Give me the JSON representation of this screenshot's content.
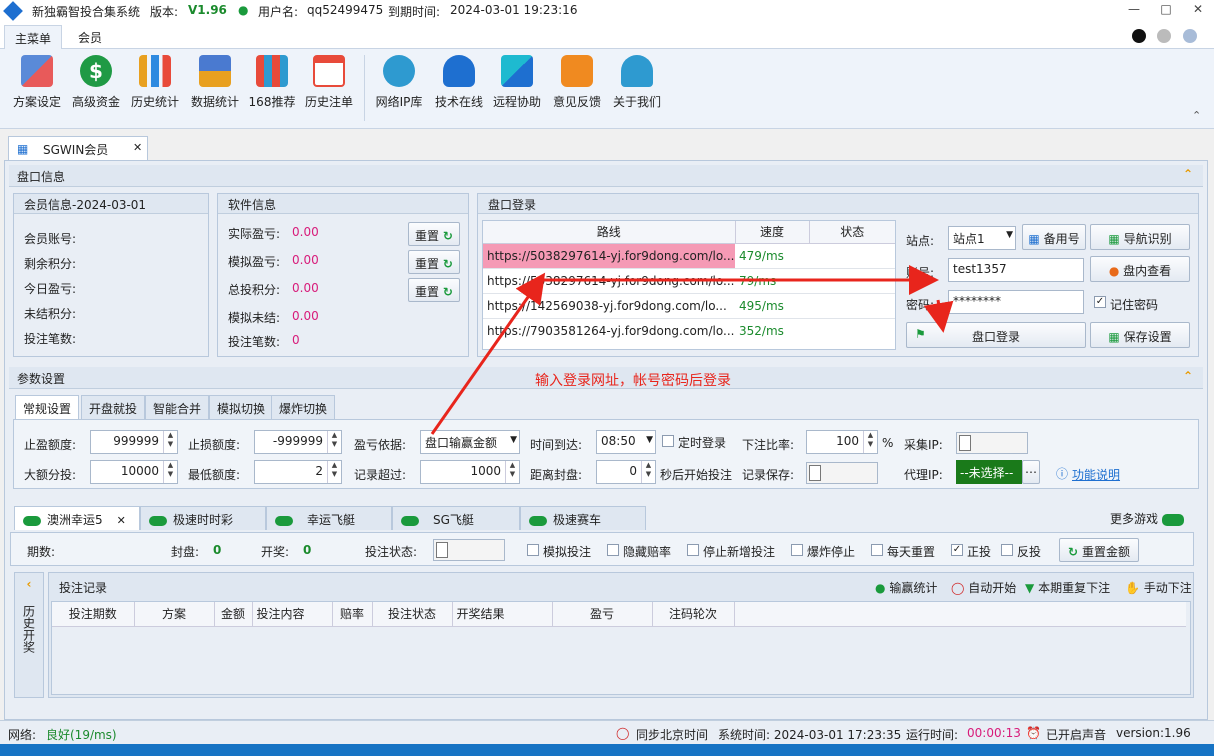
{
  "titlebar": {
    "app_name": "新独霸智投合集系统",
    "version_label": "版本:",
    "version": "V1.96",
    "user_label": "用户名:",
    "username": "qq52499475",
    "expire_label": "到期时间:",
    "expire_time": "2024-03-01 19:23:16"
  },
  "menu_tabs": [
    "主菜单",
    "会员"
  ],
  "ribbon": [
    "方案设定",
    "高级资金",
    "历史统计",
    "数据统计",
    "168推荐",
    "历史注单",
    "网络IP库",
    "技术在线",
    "远程协助",
    "意见反馈",
    "关于我们"
  ],
  "doc_tab": "SGWIN会员",
  "panels": {
    "market": "盘口信息",
    "member_info": "会员信息-2024-03-01",
    "software_info": "软件信息",
    "login": "盘口登录",
    "params": "参数设置"
  },
  "member_fields": [
    "会员账号:",
    "剩余积分:",
    "今日盈亏:",
    "未结积分:",
    "投注笔数:"
  ],
  "software_fields": [
    {
      "label": "实际盈亏:",
      "value": "0.00"
    },
    {
      "label": "模拟盈亏:",
      "value": "0.00"
    },
    {
      "label": "总投积分:",
      "value": "0.00"
    },
    {
      "label": "模拟未结:",
      "value": "0.00"
    },
    {
      "label": "投注笔数:",
      "value": "0"
    }
  ],
  "reset_label": "重置",
  "routes": {
    "headers": [
      "路线",
      "速度",
      "状态"
    ],
    "rows": [
      {
        "url": "https://5038297614-yj.for9dong.com/lo...",
        "speed": "479/ms"
      },
      {
        "url": "https://5038297614-yj.for9dong.com/lo...",
        "speed": "79/ms"
      },
      {
        "url": "https://142569038-yj.for9dong.com/lo...",
        "speed": "495/ms"
      },
      {
        "url": "https://7903581264-yj.for9dong.com/lo...",
        "speed": "352/ms"
      }
    ]
  },
  "login": {
    "site_label": "站点:",
    "site_value": "站点1",
    "backup": "备用号",
    "nav": "导航识别",
    "account_label": "账号:",
    "account": "test1357",
    "view_inside": "盘内查看",
    "password_label": "密码:",
    "password": "********",
    "remember": "记住密码",
    "login_btn": "盘口登录",
    "save_btn": "保存设置"
  },
  "annotation": "输入登录网址，帐号密码后登录",
  "param_tabs": [
    "常规设置",
    "开盘就投",
    "智能合并",
    "模拟切换",
    "爆炸切换"
  ],
  "params": {
    "stop_profit_label": "止盈额度:",
    "stop_profit": "999999",
    "stop_loss_label": "止损额度:",
    "stop_loss": "-999999",
    "basis_label": "盈亏依据:",
    "basis": "盘口输赢金额",
    "time_label": "时间到达:",
    "time": "08:50",
    "timed_login": "定时登录",
    "ratio_label": "下注比率:",
    "ratio": "100",
    "ratio_unit": "%",
    "collect_ip_label": "采集IP:",
    "split_label": "大额分投:",
    "split": "10000",
    "min_label": "最低额度:",
    "min": "2",
    "record_label": "记录超过:",
    "record": "1000",
    "close_label": "距离封盘:",
    "close": "0",
    "close_suffix": "秒后开始投注",
    "record_save_label": "记录保存:",
    "proxy_label": "代理IP:",
    "proxy": "--未选择--",
    "help": "功能说明"
  },
  "game_tabs": [
    "澳洲幸运5",
    "极速时时彩",
    "幸运飞艇",
    "SG飞艇",
    "极速赛车"
  ],
  "more_games": "更多游戏",
  "game_bar": {
    "period": "期数:",
    "close": "封盘:",
    "close_val": "0",
    "draw": "开奖:",
    "draw_val": "0",
    "bet_state": "投注状态:",
    "checks": [
      {
        "label": "模拟投注",
        "on": false
      },
      {
        "label": "隐藏赔率",
        "on": false
      },
      {
        "label": "停止新增投注",
        "on": false
      },
      {
        "label": "爆炸停止",
        "on": false
      },
      {
        "label": "每天重置",
        "on": false
      },
      {
        "label": "正投",
        "on": true
      },
      {
        "label": "反投",
        "on": false
      }
    ],
    "reset_amount": "重置金额"
  },
  "history_side": "历史开奖",
  "records": {
    "title": "投注记录",
    "actions": [
      "输赢统计",
      "自动开始",
      "本期重复下注",
      "手动下注"
    ],
    "headers": [
      "投注期数",
      "方案",
      "金额",
      "投注内容",
      "赔率",
      "投注状态",
      "开奖结果",
      "盈亏",
      "注码轮次"
    ]
  },
  "status": {
    "net_label": "网络:",
    "net": "良好(19/ms)",
    "sync": "同步北京时间",
    "sys_time": "系统时间: 2024-03-01 17:23:35",
    "run_label": "运行时间:",
    "run": "00:00:13",
    "sound": "已开启声音",
    "version": "version:1.96"
  }
}
